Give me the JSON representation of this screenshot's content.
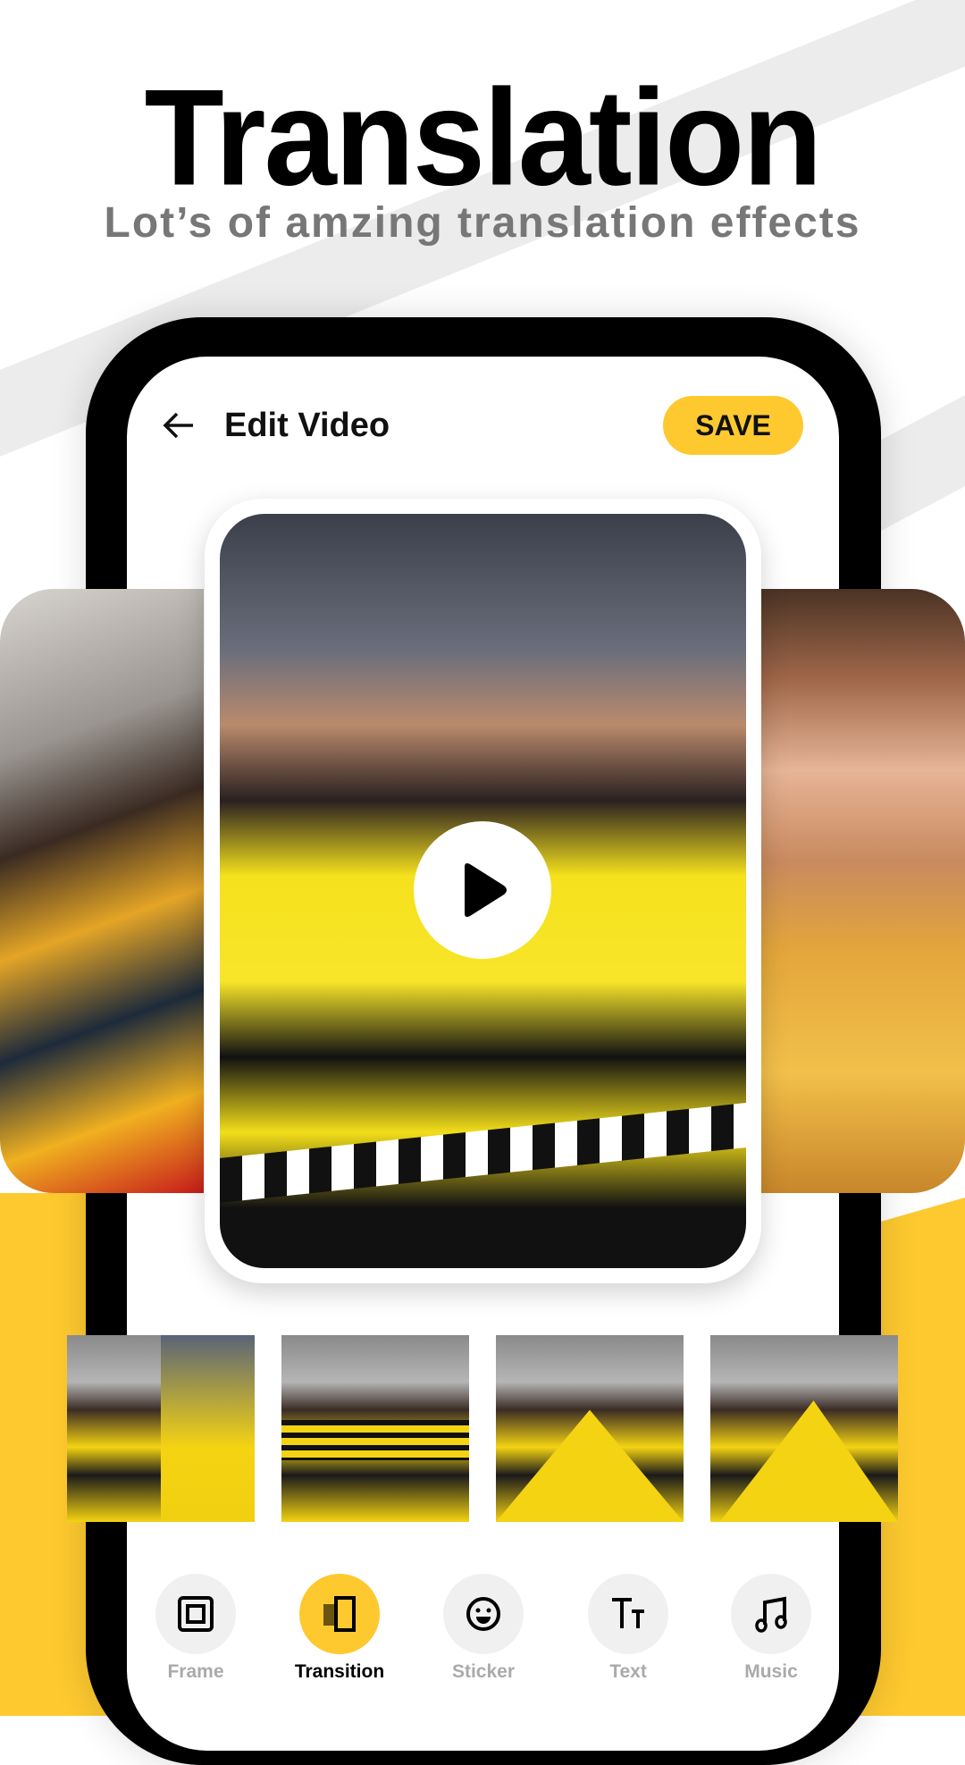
{
  "promo": {
    "title": "Translation",
    "subtitle": "Lot’s of amzing translation effects"
  },
  "colors": {
    "accent": "#fdc92f",
    "text": "#111111",
    "subtitle": "#777777",
    "inactive_label": "#aaaaaa"
  },
  "header": {
    "back_icon": "arrow-left-icon",
    "title": "Edit Video",
    "save_label": "SAVE"
  },
  "preview": {
    "play_icon": "play-icon"
  },
  "transitions": [
    {
      "name": "split-vertical"
    },
    {
      "name": "stripes"
    },
    {
      "name": "diagonal"
    },
    {
      "name": "triangle"
    }
  ],
  "toolbar": {
    "items": [
      {
        "label": "Frame",
        "icon": "frame-icon",
        "active": false
      },
      {
        "label": "Transition",
        "icon": "transition-icon",
        "active": true
      },
      {
        "label": "Sticker",
        "icon": "smiley-icon",
        "active": false
      },
      {
        "label": "Text",
        "icon": "text-size-icon",
        "active": false
      },
      {
        "label": "Music",
        "icon": "music-note-icon",
        "active": false
      }
    ]
  }
}
